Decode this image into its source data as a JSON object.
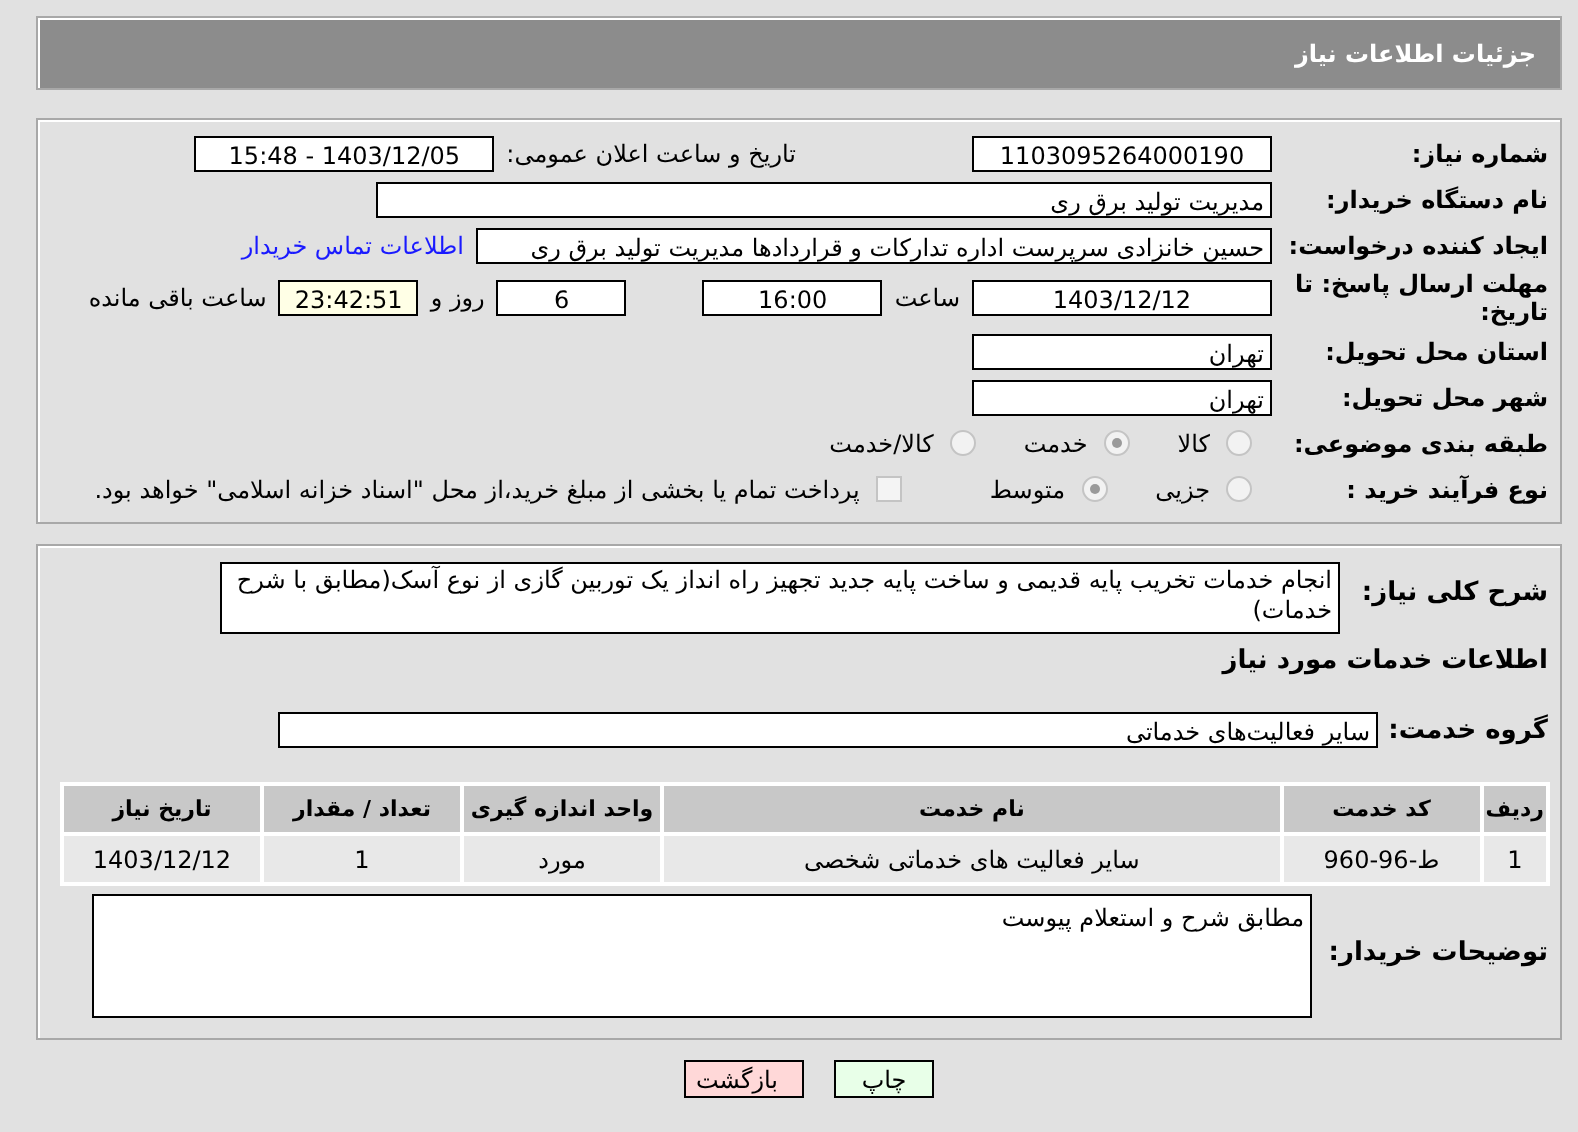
{
  "header": {
    "title": "جزئیات اطلاعات نیاز"
  },
  "need_number": {
    "label": "شماره نیاز:",
    "value": "1103095264000190"
  },
  "announce_date": {
    "label": "تاریخ و ساعت اعلان عمومی:",
    "value": "1403/12/05 - 15:48"
  },
  "buyer_org": {
    "label": "نام دستگاه خریدار:",
    "value": "مدیریت تولید برق ری"
  },
  "requester": {
    "label": "ایجاد کننده درخواست:",
    "value": "حسین خانزادی سرپرست اداره تدارکات و قراردادها مدیریت تولید برق ری",
    "link": "اطلاعات تماس خریدار"
  },
  "deadline": {
    "label": "مهلت ارسال پاسخ: تا تاریخ:",
    "date": "1403/12/12",
    "time_label": "ساعت",
    "time": "16:00",
    "days": "6",
    "days_label": "روز و",
    "remaining": "23:42:51",
    "remaining_label": "ساعت باقی مانده"
  },
  "province": {
    "label": "استان محل تحویل:",
    "value": "تهران"
  },
  "city": {
    "label": "شهر محل تحویل:",
    "value": "تهران"
  },
  "category": {
    "label": "طبقه بندی موضوعی:",
    "options": [
      {
        "label": "کالا",
        "selected": false
      },
      {
        "label": "خدمت",
        "selected": true
      },
      {
        "label": "کالا/خدمت",
        "selected": false
      }
    ]
  },
  "purchase_type": {
    "label": "نوع فرآیند خرید :",
    "options": [
      {
        "label": "جزیی",
        "selected": false
      },
      {
        "label": "متوسط",
        "selected": true
      }
    ],
    "treasury": {
      "checked": false,
      "text": "پرداخت تمام یا بخشی از مبلغ خرید،از محل \"اسناد خزانه اسلامی\" خواهد بود."
    }
  },
  "description": {
    "label": "شرح کلی نیاز:",
    "value": "انجام خدمات تخریب پایه قدیمی و ساخت پایه جدید تجهیز راه انداز یک توربین گازی از نوع  آسک(مطابق با شرح خدمات)"
  },
  "services_heading": "اطلاعات خدمات مورد نیاز",
  "service_group": {
    "label": "گروه خدمت:",
    "value": "سایر فعالیت‌های خدماتی"
  },
  "table": {
    "columns": [
      "ردیف",
      "کد خدمت",
      "نام خدمت",
      "واحد اندازه گیری",
      "تعداد / مقدار",
      "تاریخ نیاز"
    ],
    "rows": [
      [
        "1",
        "ط-96-960",
        "سایر فعالیت های خدماتی شخصی",
        "مورد",
        "1",
        "1403/12/12"
      ]
    ]
  },
  "buyer_notes": {
    "label": "توضیحات خریدار:",
    "value": "مطابق شرح و استعلام پیوست"
  },
  "buttons": [
    {
      "label": "چاپ",
      "kind": "print"
    },
    {
      "label": "بازگشت",
      "kind": "back"
    }
  ]
}
